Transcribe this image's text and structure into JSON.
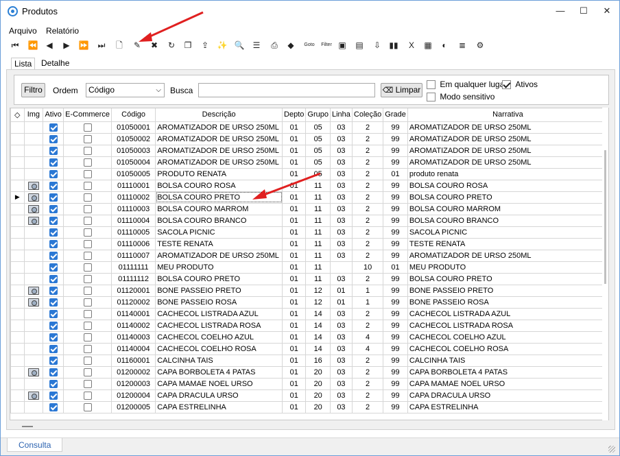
{
  "window": {
    "title": "Produtos",
    "minimize": "—",
    "maximize": "☐",
    "close": "✕"
  },
  "menu": [
    "Arquivo",
    "Relatório"
  ],
  "toolbar": [
    {
      "name": "first-record-icon",
      "glyph": "⏮"
    },
    {
      "name": "prev-page-icon",
      "glyph": "⏪"
    },
    {
      "name": "prev-record-icon",
      "glyph": "◀"
    },
    {
      "name": "next-record-icon",
      "glyph": "▶"
    },
    {
      "name": "next-page-icon",
      "glyph": "⏩"
    },
    {
      "name": "last-record-icon",
      "glyph": "⏭"
    },
    {
      "name": "new-document-icon",
      "glyph": "🗋"
    },
    {
      "name": "edit-document-icon",
      "glyph": "✎"
    },
    {
      "name": "delete-icon",
      "glyph": "✖"
    },
    {
      "name": "refresh-icon",
      "glyph": "↻"
    },
    {
      "name": "copy-icon",
      "glyph": "❐"
    },
    {
      "name": "export-icon",
      "glyph": "⇪"
    },
    {
      "name": "wand-icon",
      "glyph": "✨"
    },
    {
      "name": "search-document-icon",
      "glyph": "🔍"
    },
    {
      "name": "document-list-icon",
      "glyph": "☰"
    },
    {
      "name": "print-icon",
      "glyph": "⎙"
    },
    {
      "name": "tag-icon",
      "glyph": "◆"
    },
    {
      "name": "goto-icon",
      "glyph": "Goto"
    },
    {
      "name": "filter-icon",
      "glyph": "Filter"
    },
    {
      "name": "user-photo-icon",
      "glyph": "▣"
    },
    {
      "name": "product-image-icon",
      "glyph": "▤"
    },
    {
      "name": "import-icon",
      "glyph": "⇩"
    },
    {
      "name": "barcode-icon",
      "glyph": "▮▮"
    },
    {
      "name": "excel-icon",
      "glyph": "X"
    },
    {
      "name": "calculator-icon",
      "glyph": "▦"
    },
    {
      "name": "chart-icon",
      "glyph": "◐"
    },
    {
      "name": "notes-icon",
      "glyph": "≣"
    },
    {
      "name": "settings-icon",
      "glyph": "⚙"
    }
  ],
  "tabs": [
    "Lista",
    "Detalhe"
  ],
  "filter": {
    "filtro_label": "Filtro",
    "ordem_label": "Ordem",
    "ordem_value": "Código",
    "busca_label": "Busca",
    "busca_value": "",
    "limpar_label": "Limpar",
    "em_qualquer_lugar": "Em qualquer lugar",
    "ativos": "Ativos",
    "modo_sensitivo": "Modo sensitivo"
  },
  "grid": {
    "headers": [
      "",
      "Img",
      "Ativo",
      "E-Commerce",
      "Código",
      "Descrição",
      "Depto",
      "Grupo",
      "Linha",
      "Coleção",
      "Grade",
      "Narrativa"
    ],
    "rows": [
      {
        "img": false,
        "ativo": true,
        "ecom": false,
        "codigo": "01050001",
        "descricao": "AROMATIZADOR DE URSO 250ML",
        "depto": "01",
        "grupo": "05",
        "linha": "03",
        "colecao": "2",
        "grade": "99",
        "narrativa": "AROMATIZADOR DE URSO 250ML"
      },
      {
        "img": false,
        "ativo": true,
        "ecom": false,
        "codigo": "01050002",
        "descricao": "AROMATIZADOR DE URSO 250ML",
        "depto": "01",
        "grupo": "05",
        "linha": "03",
        "colecao": "2",
        "grade": "99",
        "narrativa": "AROMATIZADOR DE URSO 250ML"
      },
      {
        "img": false,
        "ativo": true,
        "ecom": false,
        "codigo": "01050003",
        "descricao": "AROMATIZADOR DE URSO 250ML",
        "depto": "01",
        "grupo": "05",
        "linha": "03",
        "colecao": "2",
        "grade": "99",
        "narrativa": "AROMATIZADOR DE URSO 250ML"
      },
      {
        "img": false,
        "ativo": true,
        "ecom": false,
        "codigo": "01050004",
        "descricao": "AROMATIZADOR DE URSO 250ML",
        "depto": "01",
        "grupo": "05",
        "linha": "03",
        "colecao": "2",
        "grade": "99",
        "narrativa": "AROMATIZADOR DE URSO 250ML"
      },
      {
        "img": false,
        "ativo": true,
        "ecom": false,
        "codigo": "01050005",
        "descricao": "PRODUTO RENATA",
        "depto": "01",
        "grupo": "05",
        "linha": "03",
        "colecao": "2",
        "grade": "01",
        "narrativa": "produto renata"
      },
      {
        "img": true,
        "ativo": true,
        "ecom": false,
        "codigo": "01110001",
        "descricao": "BOLSA COURO ROSA",
        "depto": "01",
        "grupo": "11",
        "linha": "03",
        "colecao": "2",
        "grade": "99",
        "narrativa": "BOLSA COURO ROSA"
      },
      {
        "img": true,
        "ativo": true,
        "ecom": false,
        "codigo": "01110002",
        "descricao": "BOLSA COURO PRETO",
        "depto": "01",
        "grupo": "11",
        "linha": "03",
        "colecao": "2",
        "grade": "99",
        "narrativa": "BOLSA COURO PRETO",
        "current": true
      },
      {
        "img": true,
        "ativo": true,
        "ecom": false,
        "codigo": "01110003",
        "descricao": "BOLSA COURO MARROM",
        "depto": "01",
        "grupo": "11",
        "linha": "03",
        "colecao": "2",
        "grade": "99",
        "narrativa": "BOLSA COURO MARROM"
      },
      {
        "img": true,
        "ativo": true,
        "ecom": false,
        "codigo": "01110004",
        "descricao": "BOLSA COURO BRANCO",
        "depto": "01",
        "grupo": "11",
        "linha": "03",
        "colecao": "2",
        "grade": "99",
        "narrativa": "BOLSA COURO BRANCO"
      },
      {
        "img": false,
        "ativo": true,
        "ecom": false,
        "codigo": "01110005",
        "descricao": "SACOLA PICNIC",
        "depto": "01",
        "grupo": "11",
        "linha": "03",
        "colecao": "2",
        "grade": "99",
        "narrativa": "SACOLA PICNIC"
      },
      {
        "img": false,
        "ativo": true,
        "ecom": false,
        "codigo": "01110006",
        "descricao": "TESTE RENATA",
        "depto": "01",
        "grupo": "11",
        "linha": "03",
        "colecao": "2",
        "grade": "99",
        "narrativa": "TESTE RENATA"
      },
      {
        "img": false,
        "ativo": true,
        "ecom": false,
        "codigo": "01110007",
        "descricao": "AROMATIZADOR DE URSO 250ML",
        "depto": "01",
        "grupo": "11",
        "linha": "03",
        "colecao": "2",
        "grade": "99",
        "narrativa": "AROMATIZADOR DE URSO 250ML"
      },
      {
        "img": false,
        "ativo": true,
        "ecom": false,
        "codigo": "01111111",
        "descricao": "MEU PRODUTO",
        "depto": "01",
        "grupo": "11",
        "linha": "",
        "colecao": "10",
        "grade": "01",
        "narrativa": "MEU PRODUTO"
      },
      {
        "img": false,
        "ativo": true,
        "ecom": false,
        "codigo": "01111112",
        "descricao": "BOLSA COURO PRETO",
        "depto": "01",
        "grupo": "11",
        "linha": "03",
        "colecao": "2",
        "grade": "99",
        "narrativa": "BOLSA COURO PRETO"
      },
      {
        "img": true,
        "ativo": true,
        "ecom": false,
        "codigo": "01120001",
        "descricao": "BONE PASSEIO PRETO",
        "depto": "01",
        "grupo": "12",
        "linha": "01",
        "colecao": "1",
        "grade": "99",
        "narrativa": "BONE PASSEIO PRETO"
      },
      {
        "img": true,
        "ativo": true,
        "ecom": false,
        "codigo": "01120002",
        "descricao": "BONE PASSEIO ROSA",
        "depto": "01",
        "grupo": "12",
        "linha": "01",
        "colecao": "1",
        "grade": "99",
        "narrativa": "BONE PASSEIO ROSA"
      },
      {
        "img": false,
        "ativo": true,
        "ecom": false,
        "codigo": "01140001",
        "descricao": "CACHECOL LISTRADA AZUL",
        "depto": "01",
        "grupo": "14",
        "linha": "03",
        "colecao": "2",
        "grade": "99",
        "narrativa": "CACHECOL LISTRADA AZUL"
      },
      {
        "img": false,
        "ativo": true,
        "ecom": false,
        "codigo": "01140002",
        "descricao": "CACHECOL LISTRADA ROSA",
        "depto": "01",
        "grupo": "14",
        "linha": "03",
        "colecao": "2",
        "grade": "99",
        "narrativa": "CACHECOL LISTRADA ROSA"
      },
      {
        "img": false,
        "ativo": true,
        "ecom": false,
        "codigo": "01140003",
        "descricao": "CACHECOL COELHO AZUL",
        "depto": "01",
        "grupo": "14",
        "linha": "03",
        "colecao": "4",
        "grade": "99",
        "narrativa": "CACHECOL COELHO AZUL"
      },
      {
        "img": false,
        "ativo": true,
        "ecom": false,
        "codigo": "01140004",
        "descricao": "CACHECOL COELHO ROSA",
        "depto": "01",
        "grupo": "14",
        "linha": "03",
        "colecao": "4",
        "grade": "99",
        "narrativa": "CACHECOL COELHO ROSA"
      },
      {
        "img": false,
        "ativo": true,
        "ecom": false,
        "codigo": "01160001",
        "descricao": "CALCINHA TAIS",
        "depto": "01",
        "grupo": "16",
        "linha": "03",
        "colecao": "2",
        "grade": "99",
        "narrativa": "CALCINHA TAIS"
      },
      {
        "img": true,
        "ativo": true,
        "ecom": false,
        "codigo": "01200002",
        "descricao": "CAPA BORBOLETA 4 PATAS",
        "depto": "01",
        "grupo": "20",
        "linha": "03",
        "colecao": "2",
        "grade": "99",
        "narrativa": "CAPA BORBOLETA 4 PATAS"
      },
      {
        "img": false,
        "ativo": true,
        "ecom": false,
        "codigo": "01200003",
        "descricao": "CAPA MAMAE NOEL URSO",
        "depto": "01",
        "grupo": "20",
        "linha": "03",
        "colecao": "2",
        "grade": "99",
        "narrativa": "CAPA MAMAE NOEL URSO"
      },
      {
        "img": true,
        "ativo": true,
        "ecom": false,
        "codigo": "01200004",
        "descricao": "CAPA DRACULA URSO",
        "depto": "01",
        "grupo": "20",
        "linha": "03",
        "colecao": "2",
        "grade": "99",
        "narrativa": "CAPA DRACULA URSO"
      },
      {
        "img": false,
        "ativo": true,
        "ecom": false,
        "codigo": "01200005",
        "descricao": "CAPA ESTRELINHA",
        "depto": "01",
        "grupo": "20",
        "linha": "03",
        "colecao": "2",
        "grade": "99",
        "narrativa": "CAPA ESTRELINHA"
      }
    ]
  },
  "status": {
    "tab": "Consulta"
  },
  "colors": {
    "accent": "#2b78d4",
    "annotation_arrow": "#e02020"
  }
}
